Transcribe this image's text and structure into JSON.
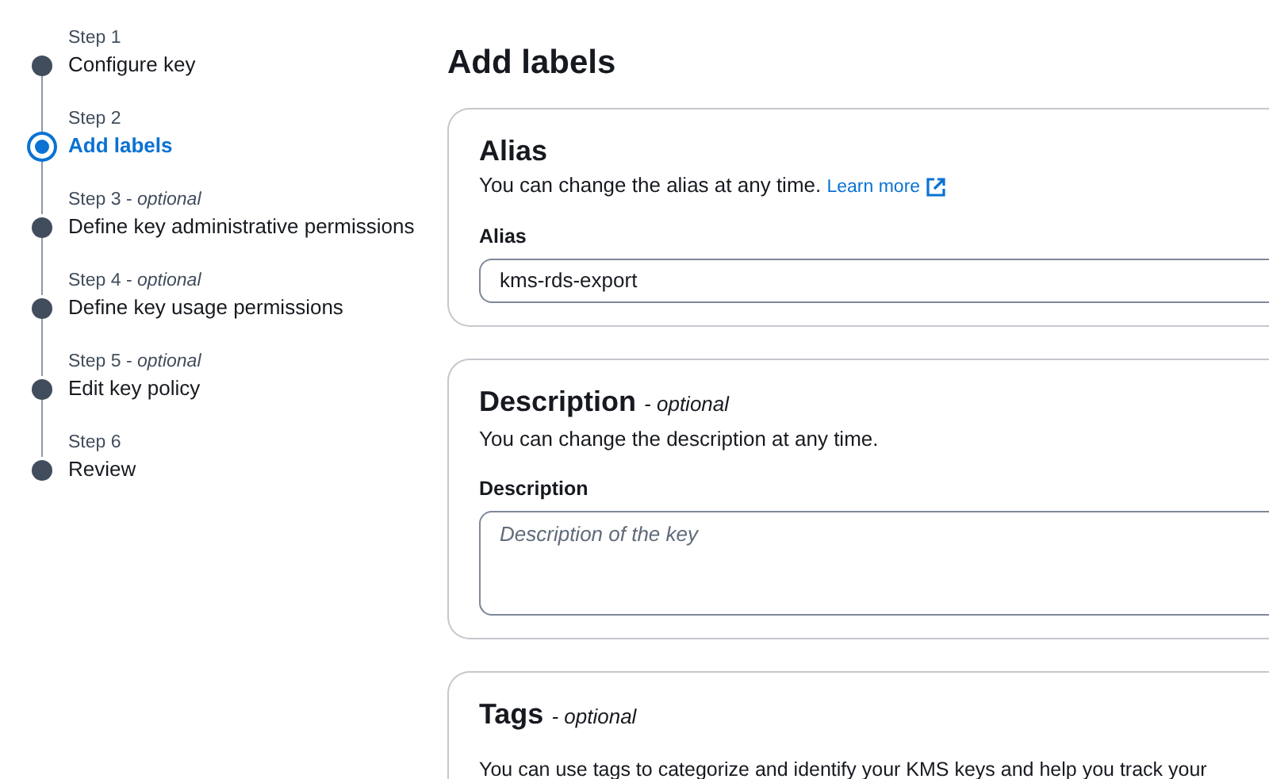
{
  "steps": [
    {
      "label": "Step 1",
      "title": "Configure key",
      "selected": false
    },
    {
      "label": "Step 2",
      "title": "Add labels",
      "selected": true
    },
    {
      "label": "Step 3 - *optional*",
      "title": "Define key administrative permissions",
      "selected": false
    },
    {
      "label": "Step 4 - *optional*",
      "title": "Define key usage permissions",
      "selected": false
    },
    {
      "label": "Step 5 - *optional*",
      "title": "Edit key policy",
      "selected": false
    },
    {
      "label": "Step 6",
      "title": "Review",
      "selected": false
    }
  ],
  "page_title": "Add labels",
  "sections": [
    {
      "kind": "input",
      "title": "Alias",
      "description": "You can change the alias at any time.",
      "link": "Learn more",
      "field_label": "Alias",
      "value": "kms-rds-export"
    },
    {
      "kind": "textarea",
      "title": "Description",
      "optional_note": "- optional",
      "description": "You can change the description at any time.",
      "field_label": "Description",
      "placeholder": "Description of the key"
    },
    {
      "kind": "text",
      "title": "Tags",
      "optional_note": "- optional",
      "description": "You can use tags to categorize and identify your KMS keys and help you track your"
    }
  ]
}
